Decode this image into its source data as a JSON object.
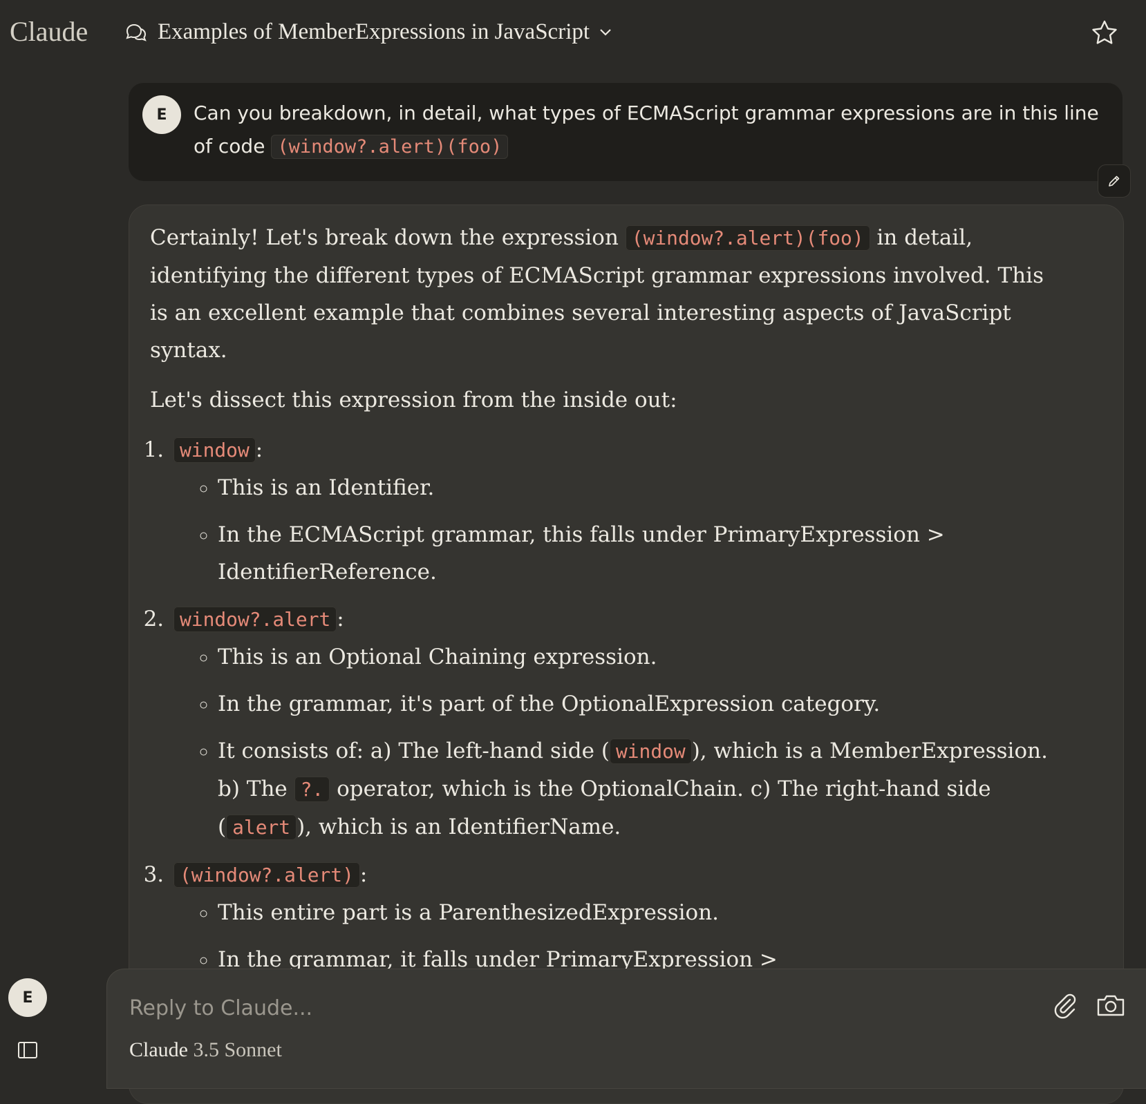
{
  "app": {
    "logo": "Claude"
  },
  "header": {
    "chat_title": "Examples of MemberExpressions in JavaScript"
  },
  "user": {
    "initial": "E"
  },
  "user_message": {
    "text_before": "Can you breakdown, in detail, what types of ECMAScript grammar expressions are in this line of code",
    "code": "(window?.alert)(foo)"
  },
  "assistant": {
    "intro_before": "Certainly! Let's break down the expression",
    "intro_code": "(window?.alert)(foo)",
    "intro_after": "in detail, identifying the different types of ECMAScript grammar expressions involved. This is an excellent example that combines several interesting aspects of JavaScript syntax.",
    "lead": "Let's dissect this expression from the inside out:",
    "items": [
      {
        "code": "window",
        "bullets": [
          "This is an Identifier.",
          "In the ECMAScript grammar, this falls under PrimaryExpression > IdentifierReference."
        ]
      },
      {
        "code": "window?.alert",
        "bullets": [
          "This is an Optional Chaining expression.",
          "In the grammar, it's part of the OptionalExpression category."
        ],
        "consists": {
          "t1": "It consists of: a) The left-hand side (",
          "c1": "window",
          "t2": "), which is a MemberExpression. b) The",
          "c2": "?.",
          "t3": "operator, which is the OptionalChain. c) The right-hand side (",
          "c3": "alert",
          "t4": "), which is an IdentifierName."
        }
      },
      {
        "code": "(window?.alert)",
        "bullets": [
          "This entire part is a ParenthesizedExpression.",
          "In the grammar, it falls under PrimaryExpression > CoverParenthesizedExpressionAndArrowParameterList."
        ]
      }
    ]
  },
  "composer": {
    "placeholder": "Reply to Claude...",
    "model_name": "Claude",
    "model_version": "3.5 Sonnet"
  },
  "icons": {
    "chat": "chat-bubbles-icon",
    "chevron": "chevron-down-icon",
    "star": "star-icon",
    "edit": "pencil-icon",
    "attach": "paperclip-icon",
    "camera": "camera-icon",
    "sidebar": "sidebar-toggle-icon"
  },
  "colors": {
    "background": "#2b2a27",
    "user_bubble": "#1f1e1b",
    "assistant_bubble": "#353430",
    "code_text": "#e58a78",
    "text": "#ece9e1"
  }
}
